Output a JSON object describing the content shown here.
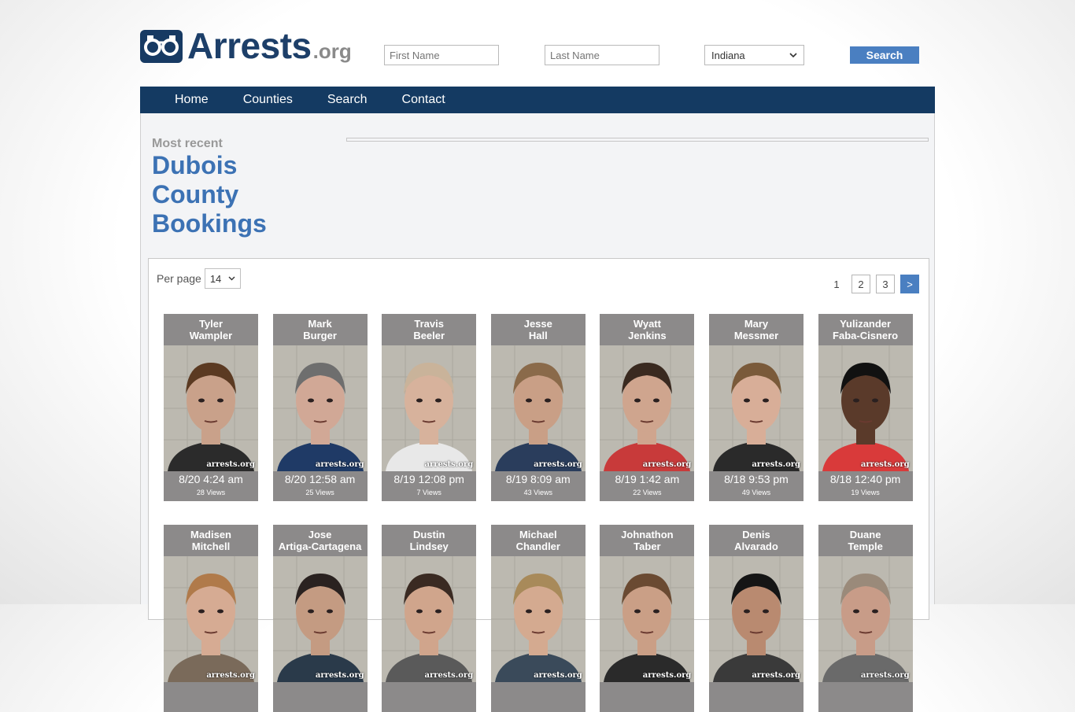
{
  "logo": {
    "main": "Arrests",
    "ext": ".org"
  },
  "search": {
    "first_placeholder": "First Name",
    "last_placeholder": "Last Name",
    "state": "Indiana",
    "button": "Search"
  },
  "nav": [
    "Home",
    "Counties",
    "Search",
    "Contact"
  ],
  "heading": {
    "most_recent": "Most recent",
    "title_lines": [
      "Dubois",
      "County",
      "Bookings"
    ]
  },
  "per_page": {
    "label": "Per page",
    "value": "14"
  },
  "pagination": {
    "pages": [
      "1",
      "2",
      "3"
    ],
    "next": ">"
  },
  "watermark": "arrests.org",
  "bookings": [
    {
      "first": "Tyler",
      "last": "Wampler",
      "time": "8/20 4:24 am",
      "views": "28 Views"
    },
    {
      "first": "Mark",
      "last": "Burger",
      "time": "8/20 12:58 am",
      "views": "25 Views"
    },
    {
      "first": "Travis",
      "last": "Beeler",
      "time": "8/19 12:08 pm",
      "views": "7 Views"
    },
    {
      "first": "Jesse",
      "last": "Hall",
      "time": "8/19 8:09 am",
      "views": "43 Views"
    },
    {
      "first": "Wyatt",
      "last": "Jenkins",
      "time": "8/19 1:42 am",
      "views": "22 Views"
    },
    {
      "first": "Mary",
      "last": "Messmer",
      "time": "8/18 9:53 pm",
      "views": "49 Views"
    },
    {
      "first": "Yulizander",
      "last": "Faba-Cisnero",
      "time": "8/18 12:40 pm",
      "views": "19 Views"
    },
    {
      "first": "Madisen",
      "last": "Mitchell",
      "time": "",
      "views": ""
    },
    {
      "first": "Jose",
      "last": "Artiga-Cartagena",
      "time": "",
      "views": ""
    },
    {
      "first": "Dustin",
      "last": "Lindsey",
      "time": "",
      "views": ""
    },
    {
      "first": "Michael",
      "last": "Chandler",
      "time": "",
      "views": ""
    },
    {
      "first": "Johnathon",
      "last": "Taber",
      "time": "",
      "views": ""
    },
    {
      "first": "Denis",
      "last": "Alvarado",
      "time": "",
      "views": ""
    },
    {
      "first": "Duane",
      "last": "Temple",
      "time": "",
      "views": ""
    }
  ],
  "colors": {
    "brand_dark": "#143a62",
    "accent": "#4a7fc1",
    "card": "#8c8a8a"
  }
}
